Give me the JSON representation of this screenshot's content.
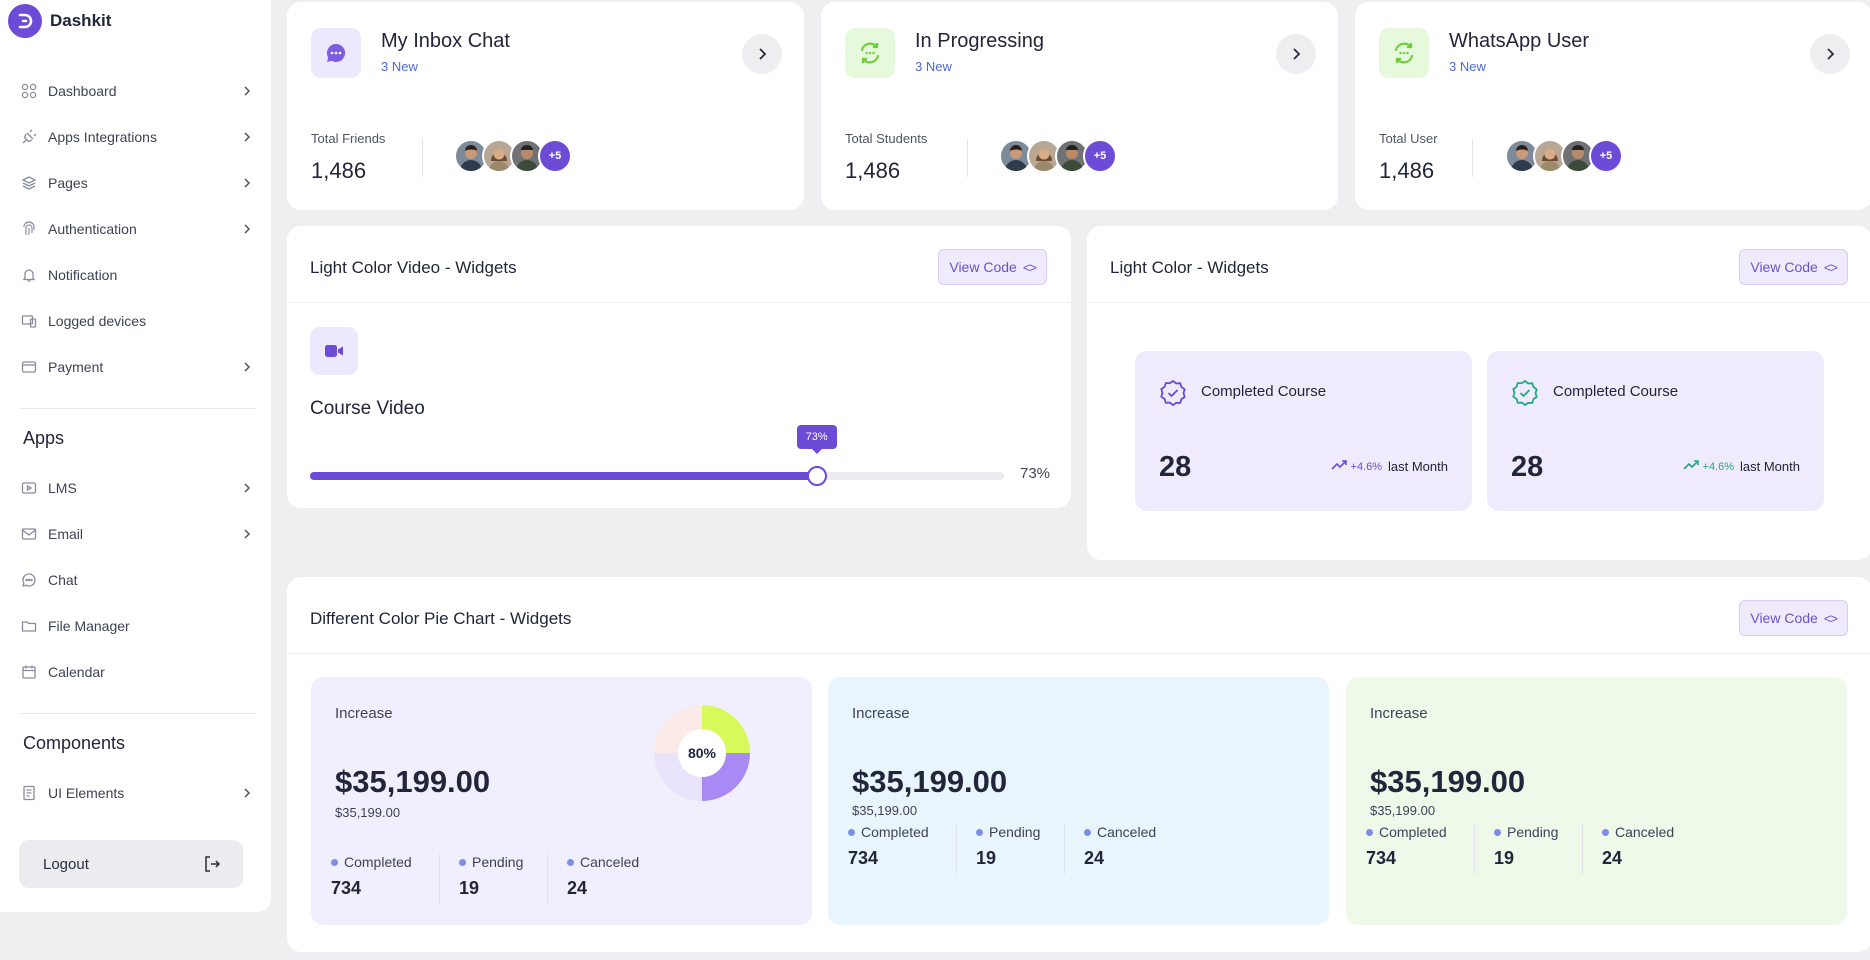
{
  "brand": {
    "name": "Dashkit"
  },
  "sidebar": {
    "items": [
      {
        "label": "Dashboard",
        "icon": "grid-icon"
      },
      {
        "label": "Apps Integrations",
        "icon": "plug-icon"
      },
      {
        "label": "Pages",
        "icon": "layers-icon"
      },
      {
        "label": "Authentication",
        "icon": "fingerprint-icon"
      },
      {
        "label": "Notification",
        "icon": "bell-icon"
      },
      {
        "label": "Logged devices",
        "icon": "devices-icon"
      },
      {
        "label": "Payment",
        "icon": "wallet-icon"
      }
    ],
    "apps_title": "Apps",
    "apps": [
      {
        "label": "LMS",
        "icon": "play-icon"
      },
      {
        "label": "Email",
        "icon": "mail-icon"
      },
      {
        "label": "Chat",
        "icon": "chat-icon"
      },
      {
        "label": "File Manager",
        "icon": "folder-icon"
      },
      {
        "label": "Calendar",
        "icon": "calendar-icon"
      }
    ],
    "components_title": "Components",
    "components": [
      {
        "label": "UI Elements",
        "icon": "document-icon"
      }
    ],
    "logout": "Logout"
  },
  "top_cards": [
    {
      "title": "My Inbox Chat",
      "sub": "3 New",
      "label": "Total Friends",
      "value": "1,486",
      "more": "+5",
      "icon_bg": "#ece8fd",
      "icon_color": "#7c5ce0"
    },
    {
      "title": "In Progressing",
      "sub": "3 New",
      "label": "Total Students",
      "value": "1,486",
      "more": "+5",
      "icon_bg": "#e6f9dc",
      "icon_color": "#6bcf3c"
    },
    {
      "title": "WhatsApp User",
      "sub": "3 New",
      "label": "Total User",
      "value": "1,486",
      "more": "+5",
      "icon_bg": "#e6f9dc",
      "icon_color": "#6bcf3c"
    }
  ],
  "video_widget": {
    "title": "Light Color Video - Widgets",
    "view_code": "View Code",
    "course_title": "Course Video",
    "progress": 73,
    "progress_label": "73%"
  },
  "light_widget": {
    "title": "Light Color - Widgets",
    "view_code": "View Code",
    "cards": [
      {
        "title": "Completed Course",
        "value": "28",
        "change": "+4.6%",
        "period": "last Month",
        "accent": "#6c4bd6"
      },
      {
        "title": "Completed Course",
        "value": "28",
        "change": "+4.6%",
        "period": "last Month",
        "accent": "#22a889"
      }
    ]
  },
  "pie_widget": {
    "title": "Different Color Pie Chart - Widgets",
    "view_code": "View Code",
    "cards": [
      {
        "label": "Increase",
        "amount": "$35,199.00",
        "sub": "$35,199.00",
        "bg": "#f1effd",
        "donut": true,
        "donut_label": "80%",
        "donut_value": 80,
        "stats": [
          {
            "label": "Completed",
            "value": "734"
          },
          {
            "label": "Pending",
            "value": "19"
          },
          {
            "label": "Canceled",
            "value": "24"
          }
        ]
      },
      {
        "label": "Increase",
        "amount": "$35,199.00",
        "sub": "$35,199.00",
        "bg": "#e9f5fc",
        "donut": false,
        "stats": [
          {
            "label": "Completed",
            "value": "734"
          },
          {
            "label": "Pending",
            "value": "19"
          },
          {
            "label": "Canceled",
            "value": "24"
          }
        ]
      },
      {
        "label": "Increase",
        "amount": "$35,199.00",
        "sub": "$35,199.00",
        "bg": "#eef9ea",
        "donut": false,
        "stats": [
          {
            "label": "Completed",
            "value": "734"
          },
          {
            "label": "Pending",
            "value": "19"
          },
          {
            "label": "Canceled",
            "value": "24"
          }
        ]
      }
    ]
  }
}
